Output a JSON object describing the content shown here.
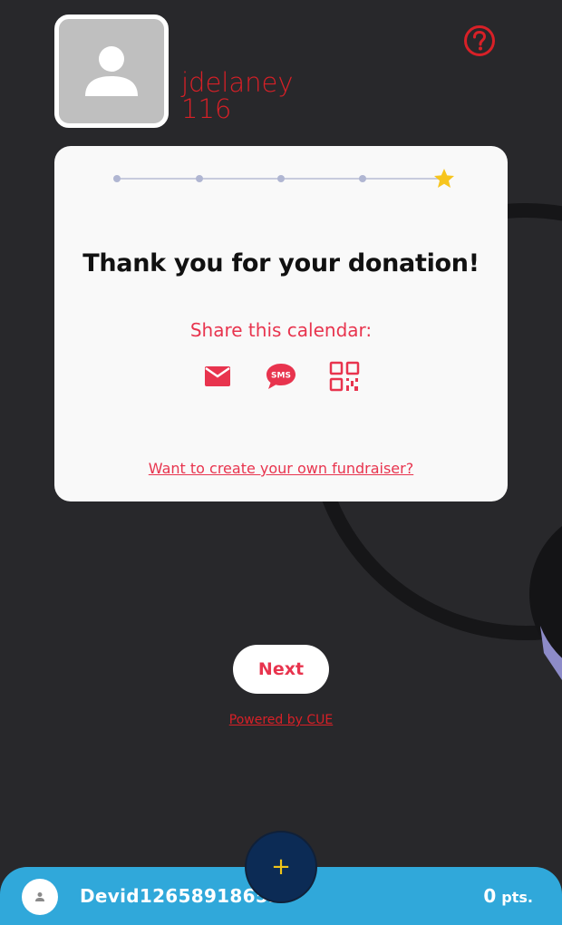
{
  "user": {
    "name": "jdelaney",
    "number": "116"
  },
  "card": {
    "title": "Thank you for your donation!",
    "share_label": "Share this calendar:",
    "share_options": [
      "email-icon",
      "sms-icon",
      "qr-code-icon"
    ],
    "create_link": "Want to create your own fundraiser?",
    "progress": {
      "steps": 5,
      "current_step": 5,
      "final_step_icon": "star-icon"
    }
  },
  "actions": {
    "next_label": "Next",
    "powered_by": "Powered by CUE"
  },
  "bottom_bar": {
    "device_id": "Devid12658918652",
    "points_value": "0",
    "points_label": "pts.",
    "fab_label": "+"
  },
  "colors": {
    "background": "#28282b",
    "accent_red": "#e8344e",
    "user_red": "#d82027",
    "bar_blue": "#30a8da",
    "fab_navy": "#0c2b55",
    "star_yellow": "#f7c51e"
  }
}
